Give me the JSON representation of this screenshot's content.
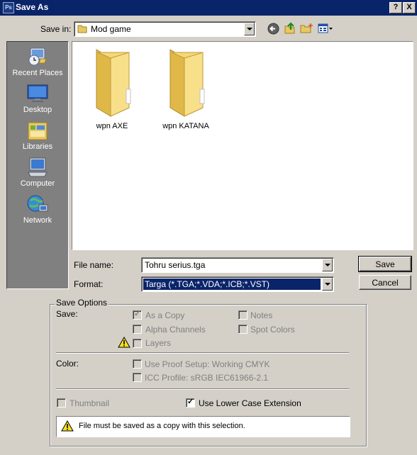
{
  "window": {
    "title": "Save As",
    "app_icon_label": "Ps",
    "minimize_label": "?",
    "close_label": "X"
  },
  "savein": {
    "label": "Save in:",
    "value": "Mod game"
  },
  "toolbar": {
    "icons": [
      "back-icon",
      "up-folder-icon",
      "new-folder-icon",
      "view-menu-icon"
    ]
  },
  "places": [
    {
      "label": "Recent Places",
      "icon": "recent-places-icon"
    },
    {
      "label": "Desktop",
      "icon": "desktop-icon"
    },
    {
      "label": "Libraries",
      "icon": "libraries-icon"
    },
    {
      "label": "Computer",
      "icon": "computer-icon"
    },
    {
      "label": "Network",
      "icon": "network-icon"
    }
  ],
  "files": [
    {
      "name": "wpn AXE"
    },
    {
      "name": "wpn KATANA"
    }
  ],
  "filename": {
    "label": "File name:",
    "value": "Tohru serius.tga"
  },
  "format": {
    "label": "Format:",
    "value": "Targa (*.TGA;*.VDA;*.ICB;*.VST)"
  },
  "buttons": {
    "save": "Save",
    "cancel": "Cancel"
  },
  "save_options": {
    "group_label": "Save Options",
    "save_label": "Save:",
    "as_a_copy": "As a Copy",
    "alpha_channels": "Alpha Channels",
    "layers": "Layers",
    "notes": "Notes",
    "spot_colors": "Spot Colors",
    "color_label": "Color:",
    "use_proof_setup": "Use Proof Setup:  Working CMYK",
    "icc_profile": "ICC Profile:  sRGB IEC61966-2.1",
    "thumbnail": "Thumbnail",
    "lowercase_ext": "Use Lower Case Extension",
    "warning_text": "File must be saved as a copy with this selection.",
    "as_a_copy_checked": true,
    "lowercase_checked": true
  }
}
